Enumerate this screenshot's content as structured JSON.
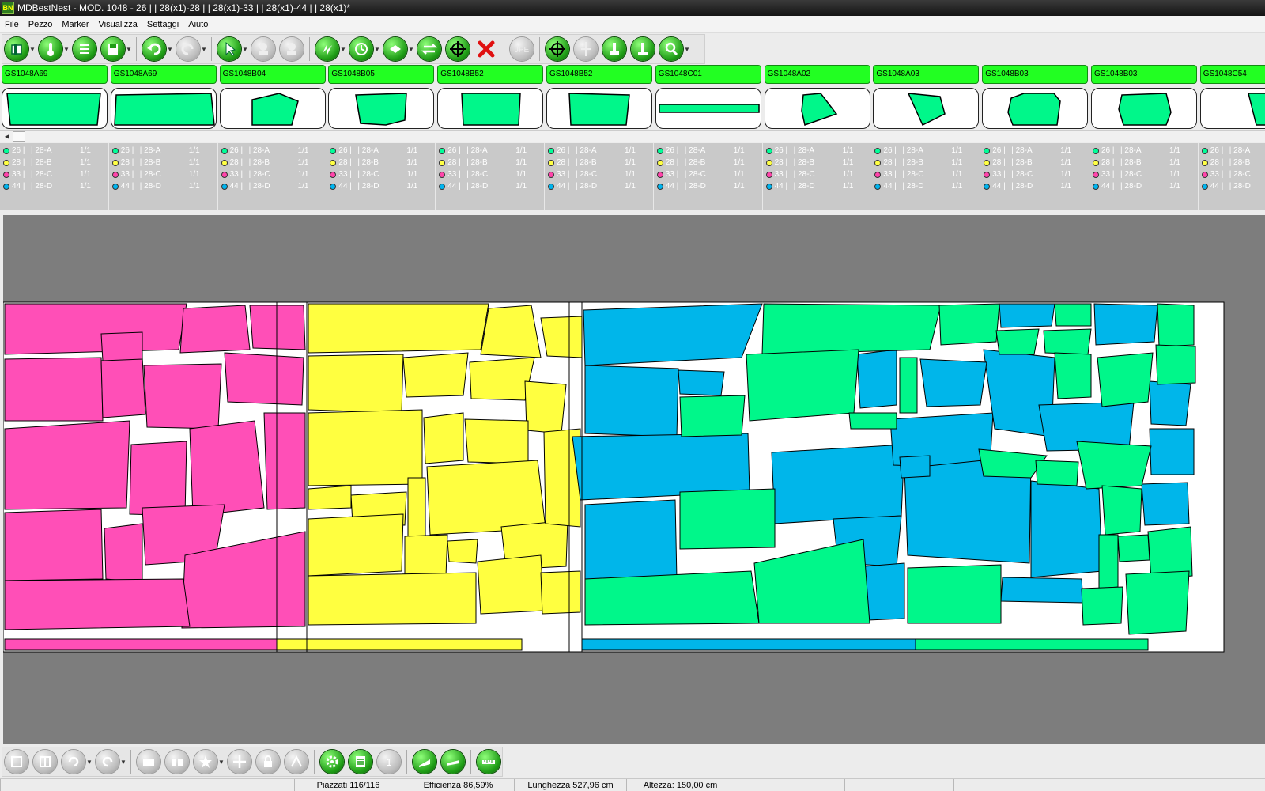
{
  "window": {
    "title": "MDBestNest - MOD. 1048 - 26 | | 28(x1)-28 | | 28(x1)-33 | | 28(x1)-44 | | 28(x1)*",
    "logo": "BN"
  },
  "menu": [
    "File",
    "Pezzo",
    "Marker",
    "Visualizza",
    "Settaggi",
    "Aiuto"
  ],
  "toolbar_top": [
    {
      "icon": "open-folder-icon",
      "state": "green",
      "dropdown": true
    },
    {
      "icon": "thermometer-icon",
      "state": "green",
      "dropdown": true
    },
    {
      "icon": "list-icon",
      "state": "green",
      "dropdown": false
    },
    {
      "icon": "save-icon",
      "state": "green",
      "dropdown": true
    },
    {
      "sep": true
    },
    {
      "icon": "undo-icon",
      "state": "green",
      "dropdown": true
    },
    {
      "icon": "redo-icon",
      "state": "disabled",
      "dropdown": true
    },
    {
      "sep": true
    },
    {
      "icon": "pointer-icon",
      "state": "green",
      "dropdown": true
    },
    {
      "icon": "add-piece-icon",
      "state": "disabled",
      "dropdown": false
    },
    {
      "icon": "remove-piece-icon",
      "state": "disabled",
      "dropdown": false
    },
    {
      "sep": true
    },
    {
      "icon": "auto-nest-icon",
      "state": "green",
      "dropdown": true
    },
    {
      "icon": "timer-nest-icon",
      "state": "green",
      "dropdown": true
    },
    {
      "icon": "compact-icon",
      "state": "green",
      "dropdown": true
    },
    {
      "icon": "flip-icon",
      "state": "green",
      "dropdown": false
    },
    {
      "icon": "crosshair-icon",
      "state": "green",
      "dropdown": false
    },
    {
      "icon": "delete-x-icon",
      "state": "red",
      "dropdown": false
    },
    {
      "sep": true
    },
    {
      "icon": "jpeg-export-icon",
      "state": "disabled",
      "dropdown": false
    },
    {
      "sep": true
    },
    {
      "icon": "target-icon",
      "state": "green",
      "dropdown": false
    },
    {
      "icon": "split-icon",
      "state": "disabled",
      "dropdown": false
    },
    {
      "icon": "measure-icon",
      "state": "green",
      "dropdown": false
    },
    {
      "icon": "info-icon",
      "state": "green",
      "dropdown": false
    },
    {
      "icon": "zoom-icon",
      "state": "green",
      "dropdown": true
    }
  ],
  "toolbar_bottom": [
    {
      "icon": "view-1-icon",
      "state": "disabled",
      "dropdown": false
    },
    {
      "icon": "view-2-icon",
      "state": "disabled",
      "dropdown": false
    },
    {
      "icon": "rotate-icon",
      "state": "disabled",
      "dropdown": true
    },
    {
      "icon": "rotate-cw-icon",
      "state": "disabled",
      "dropdown": true
    },
    {
      "sep": true
    },
    {
      "icon": "group-icon",
      "state": "disabled",
      "dropdown": false
    },
    {
      "icon": "ungroup-icon",
      "state": "disabled",
      "dropdown": false
    },
    {
      "icon": "star-icon",
      "state": "disabled",
      "dropdown": true
    },
    {
      "icon": "move-icon",
      "state": "disabled",
      "dropdown": false
    },
    {
      "icon": "lock-icon",
      "state": "disabled",
      "dropdown": false
    },
    {
      "icon": "mirror-icon",
      "state": "disabled",
      "dropdown": false
    },
    {
      "sep": true
    },
    {
      "icon": "settings-gear-icon",
      "state": "green",
      "dropdown": false
    },
    {
      "icon": "report-icon",
      "state": "green",
      "dropdown": false
    },
    {
      "icon": "number-one-icon",
      "state": "disabled",
      "dropdown": false
    },
    {
      "sep": true
    },
    {
      "icon": "plotter-icon",
      "state": "green",
      "dropdown": false
    },
    {
      "icon": "cutter-icon",
      "state": "green",
      "dropdown": false
    },
    {
      "sep": true
    },
    {
      "icon": "ruler-icon",
      "state": "green",
      "dropdown": false
    }
  ],
  "pieces": [
    {
      "label": "GS1048A69",
      "shape": "wide_left"
    },
    {
      "label": "GS1048A69",
      "shape": "wide_right"
    },
    {
      "label": "GS1048B04",
      "shape": "pent"
    },
    {
      "label": "GS1048B05",
      "shape": "pent2"
    },
    {
      "label": "GS1048B52",
      "shape": "rect"
    },
    {
      "label": "GS1048B52",
      "shape": "rect2"
    },
    {
      "label": "GS1048C01",
      "shape": "strip"
    },
    {
      "label": "GS1048A02",
      "shape": "tri"
    },
    {
      "label": "GS1048A03",
      "shape": "tri2"
    },
    {
      "label": "GS1048B03",
      "shape": "oct"
    },
    {
      "label": "GS1048B03",
      "shape": "oct2"
    },
    {
      "label": "GS1048C54",
      "shape": "partial"
    }
  ],
  "sizes": [
    {
      "size": "26 |",
      "code": "| 28-A",
      "qty": "1/1",
      "color": "#00ff99"
    },
    {
      "size": "28 |",
      "code": "| 28-B",
      "qty": "1/1",
      "color": "#ffff44"
    },
    {
      "size": "33 |",
      "code": "| 28-C",
      "qty": "1/1",
      "color": "#ff44aa"
    },
    {
      "size": "44 |",
      "code": "| 28-D",
      "qty": "1/1",
      "color": "#00b4ee"
    }
  ],
  "marker": {
    "colors": {
      "pink": "#ff4fb7",
      "yellow": "#ffff40",
      "blue": "#00b6ea",
      "green": "#00f78a",
      "background": "#7d7d7d",
      "sheet": "#ffffff"
    }
  },
  "status": {
    "placed": "Piazzati 116/116",
    "efficiency": "Efficienza 86,59%",
    "length": "Lunghezza 527,96 cm",
    "height": "Altezza: 150,00 cm"
  }
}
